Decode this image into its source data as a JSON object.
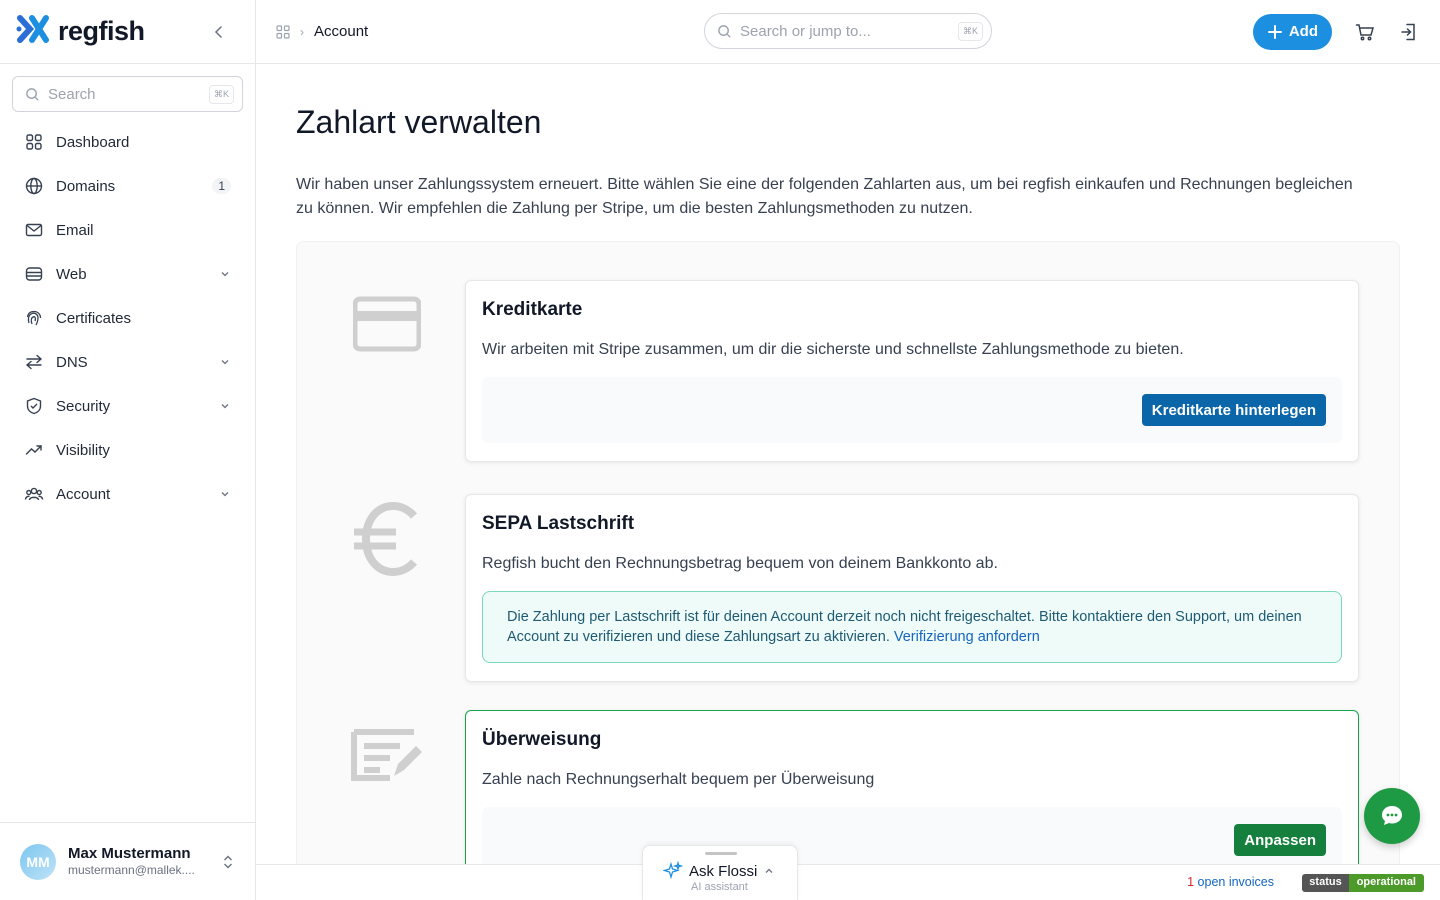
{
  "brand": {
    "name": "regfish"
  },
  "sidebar": {
    "search_placeholder": "Search",
    "search_shortcut": "⌘K",
    "items": [
      {
        "label": "Dashboard",
        "icon": "grid-icon"
      },
      {
        "label": "Domains",
        "icon": "globe-icon",
        "badge": "1"
      },
      {
        "label": "Email",
        "icon": "mail-icon"
      },
      {
        "label": "Web",
        "icon": "server-icon",
        "expandable": true
      },
      {
        "label": "Certificates",
        "icon": "fingerprint-icon"
      },
      {
        "label": "DNS",
        "icon": "arrows-icon",
        "expandable": true
      },
      {
        "label": "Security",
        "icon": "shield-icon",
        "expandable": true
      },
      {
        "label": "Visibility",
        "icon": "trending-icon"
      },
      {
        "label": "Account",
        "icon": "users-icon",
        "expandable": true
      }
    ]
  },
  "user": {
    "initials": "MM",
    "name": "Max Mustermann",
    "email": "mustermann@mallek...."
  },
  "topbar": {
    "breadcrumb": "Account",
    "search_placeholder": "Search or jump to...",
    "search_shortcut": "⌘K",
    "add_label": "Add"
  },
  "main": {
    "title": "Zahlart verwalten",
    "intro": "Wir haben unser Zahlungssystem erneuert. Bitte wählen Sie eine der folgenden Zahlarten aus, um bei regfish einkaufen und Rechnungen begleichen zu können. Wir empfehlen die Zahlung per Stripe, um die besten Zahlungsmethoden zu nutzen.",
    "methods": {
      "card": {
        "title": "Kreditkarte",
        "description": "Wir arbeiten mit Stripe zusammen, um dir die sicherste und schnellste Zahlungsmethode zu bieten.",
        "button": "Kreditkarte hinterlegen"
      },
      "sepa": {
        "title": "SEPA Lastschrift",
        "description": "Regfish bucht den Rechnungsbetrag bequem von deinem Bankkonto ab.",
        "notice": "Die Zahlung per Lastschrift ist für deinen Account derzeit noch nicht freigeschaltet. Bitte kontaktiere den Support, um deinen Account zu verifizieren und diese Zahlungsart zu aktivieren.",
        "notice_link": "Verifizierung anfordern"
      },
      "transfer": {
        "title": "Überweisung",
        "description": "Zahle nach Rechnungserhalt bequem per Überweisung",
        "button": "Anpassen"
      }
    }
  },
  "statusbar": {
    "invoices_count": "1",
    "invoices_label": "open invoices",
    "status_key": "status",
    "status_value": "operational"
  },
  "assistant": {
    "title": "Ask Flossi",
    "subtitle": "AI assistant"
  },
  "colors": {
    "primary": "#1d8fe1",
    "card_button": "#0a66a8",
    "success": "#15803d",
    "chat": "#1e9a45"
  }
}
